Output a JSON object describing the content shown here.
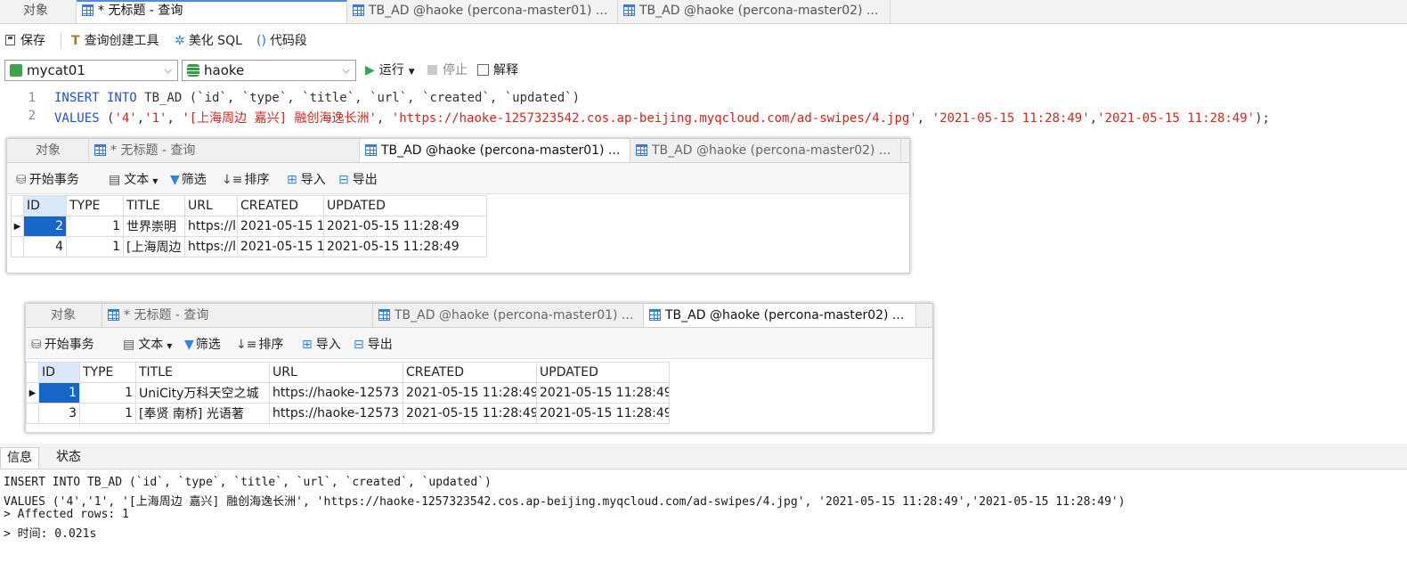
{
  "top_tabs": [
    {
      "label": "对象",
      "active": false
    },
    {
      "label": "* 无标题 - 查询",
      "active": true
    },
    {
      "label": "TB_AD @haoke (percona-master01) ...",
      "active": false
    },
    {
      "label": "TB_AD @haoke (percona-master02) ...",
      "active": false
    }
  ],
  "toolbar": {
    "save": "保存",
    "query_builder": "查询创建工具",
    "beautify": "美化 SQL",
    "snippet": "代码段"
  },
  "connection": {
    "value": "mycat01"
  },
  "database": {
    "value": "haoke"
  },
  "run": {
    "run": "运行",
    "stop": "停止",
    "explain": "解释"
  },
  "editor": {
    "line_numbers": [
      "1",
      "2"
    ],
    "line1": {
      "kw1": "INSERT INTO",
      "rest": " TB_AD (`id`, `type`, `title`, `url`, `created`, `updated`)"
    },
    "line2": {
      "kw": "VALUES",
      "p1": " (",
      "s1": "'4'",
      "c1": ",",
      "s2": "'1'",
      "c2": ", ",
      "s3": "'[上海周边 嘉兴] 融创海逸长洲'",
      "c3": ", ",
      "s4": "'https://haoke-1257323542.cos.ap-beijing.myqcloud.com/ad-swipes/4.jpg'",
      "c4": ", ",
      "s5": "'2021-05-15 11:28:49'",
      "c5": ",",
      "s6": "'2021-05-15 11:28:49'",
      "end": ");"
    }
  },
  "window1": {
    "tabs": [
      "对象",
      "* 无标题 - 查询",
      "TB_AD @haoke (percona-master01) ...",
      "TB_AD @haoke (percona-master02) ..."
    ],
    "active_tab": 2,
    "toolbar": {
      "begin": "开始事务",
      "text": "文本",
      "filter": "筛选",
      "sort": "排序",
      "import": "导入",
      "export": "导出"
    },
    "columns": [
      "ID",
      "TYPE",
      "TITLE",
      "URL",
      "CREATED",
      "UPDATED"
    ],
    "rows": [
      [
        "2",
        "1",
        "世界崇明",
        "https://l",
        "2021-05-15 1",
        "2021-05-15 11:28:49"
      ],
      [
        "4",
        "1",
        "[上海周边",
        "https://l",
        "2021-05-15 1",
        "2021-05-15 11:28:49"
      ]
    ]
  },
  "window2": {
    "tabs": [
      "对象",
      "* 无标题 - 查询",
      "TB_AD @haoke (percona-master01) ...",
      "TB_AD @haoke (percona-master02) ..."
    ],
    "active_tab": 3,
    "toolbar": {
      "begin": "开始事务",
      "text": "文本",
      "filter": "筛选",
      "sort": "排序",
      "import": "导入",
      "export": "导出"
    },
    "columns": [
      "ID",
      "TYPE",
      "TITLE",
      "URL",
      "CREATED",
      "UPDATED"
    ],
    "rows": [
      [
        "1",
        "1",
        "UniCity万科天空之城",
        "https://haoke-12573",
        "2021-05-15 11:28:49",
        "2021-05-15 11:28:49"
      ],
      [
        "3",
        "1",
        "[奉贤 南桥] 光语著",
        "https://haoke-12573",
        "2021-05-15 11:28:49",
        "2021-05-15 11:28:49"
      ]
    ]
  },
  "bottom": {
    "tabs": [
      "信息",
      "状态"
    ],
    "messages": [
      "INSERT INTO TB_AD (`id`, `type`, `title`, `url`, `created`, `updated`)",
      "VALUES ('4','1', '[上海周边 嘉兴] 融创海逸长洲', 'https://haoke-1257323542.cos.ap-beijing.myqcloud.com/ad-swipes/4.jpg', '2021-05-15 11:28:49','2021-05-15 11:28:49')",
      "> Affected rows: 1",
      "> 时间: 0.021s"
    ]
  }
}
